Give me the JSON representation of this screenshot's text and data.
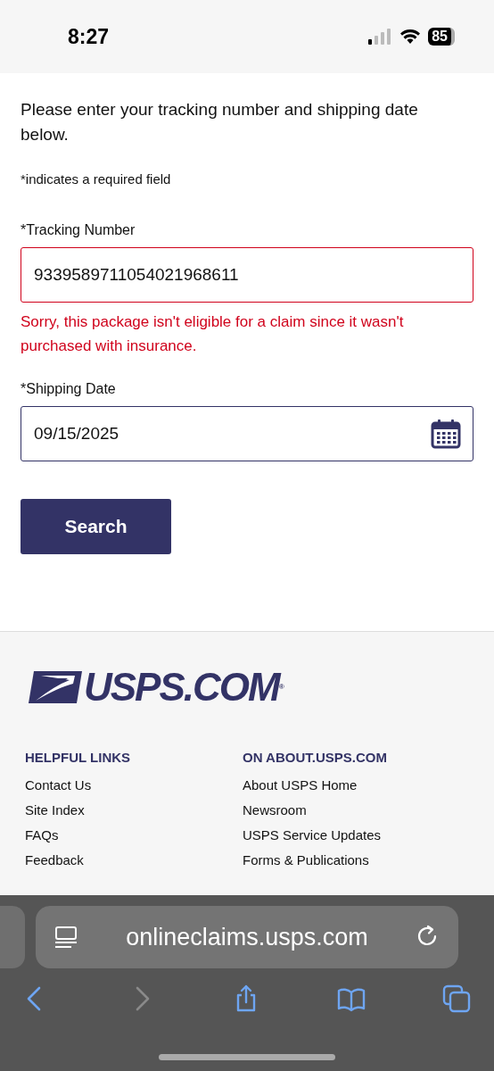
{
  "status_bar": {
    "time": "8:27",
    "battery": "85"
  },
  "form": {
    "intro": "Please enter your tracking number and shipping date below.",
    "required_note": "*indicates a required field",
    "fields": [
      {
        "kind": "text",
        "label": "*Tracking Number",
        "value": "9339589711054021968611",
        "error": "Sorry, this package isn't eligible for a claim since it wasn't purchased with insurance."
      },
      {
        "kind": "date",
        "label": "*Shipping Date",
        "value": "09/15/2025"
      }
    ],
    "submit": "Search"
  },
  "footer": {
    "logo": "USPS.COM$^{®}$",
    "columns": [
      {
        "heading": "HELPFUL LINKS",
        "links": [
          "Contact Us",
          "Site Index",
          "FAQs",
          "Feedback"
        ]
      },
      {
        "heading": "ON ABOUT.USPS.COM",
        "links": [
          "About USPS Home",
          "Newsroom",
          "USPS Service Updates",
          "Forms & Publications"
        ]
      }
    ]
  },
  "browser": {
    "url": "onlineclaims.usps.com",
    "toolbar": [
      {
        "kind": "back",
        "disabled": false
      },
      {
        "kind": "forward",
        "disabled": true
      },
      {
        "kind": "share",
        "disabled": false
      },
      {
        "kind": "bookmarks",
        "disabled": false
      },
      {
        "kind": "tabs",
        "disabled": false
      }
    ]
  }
}
